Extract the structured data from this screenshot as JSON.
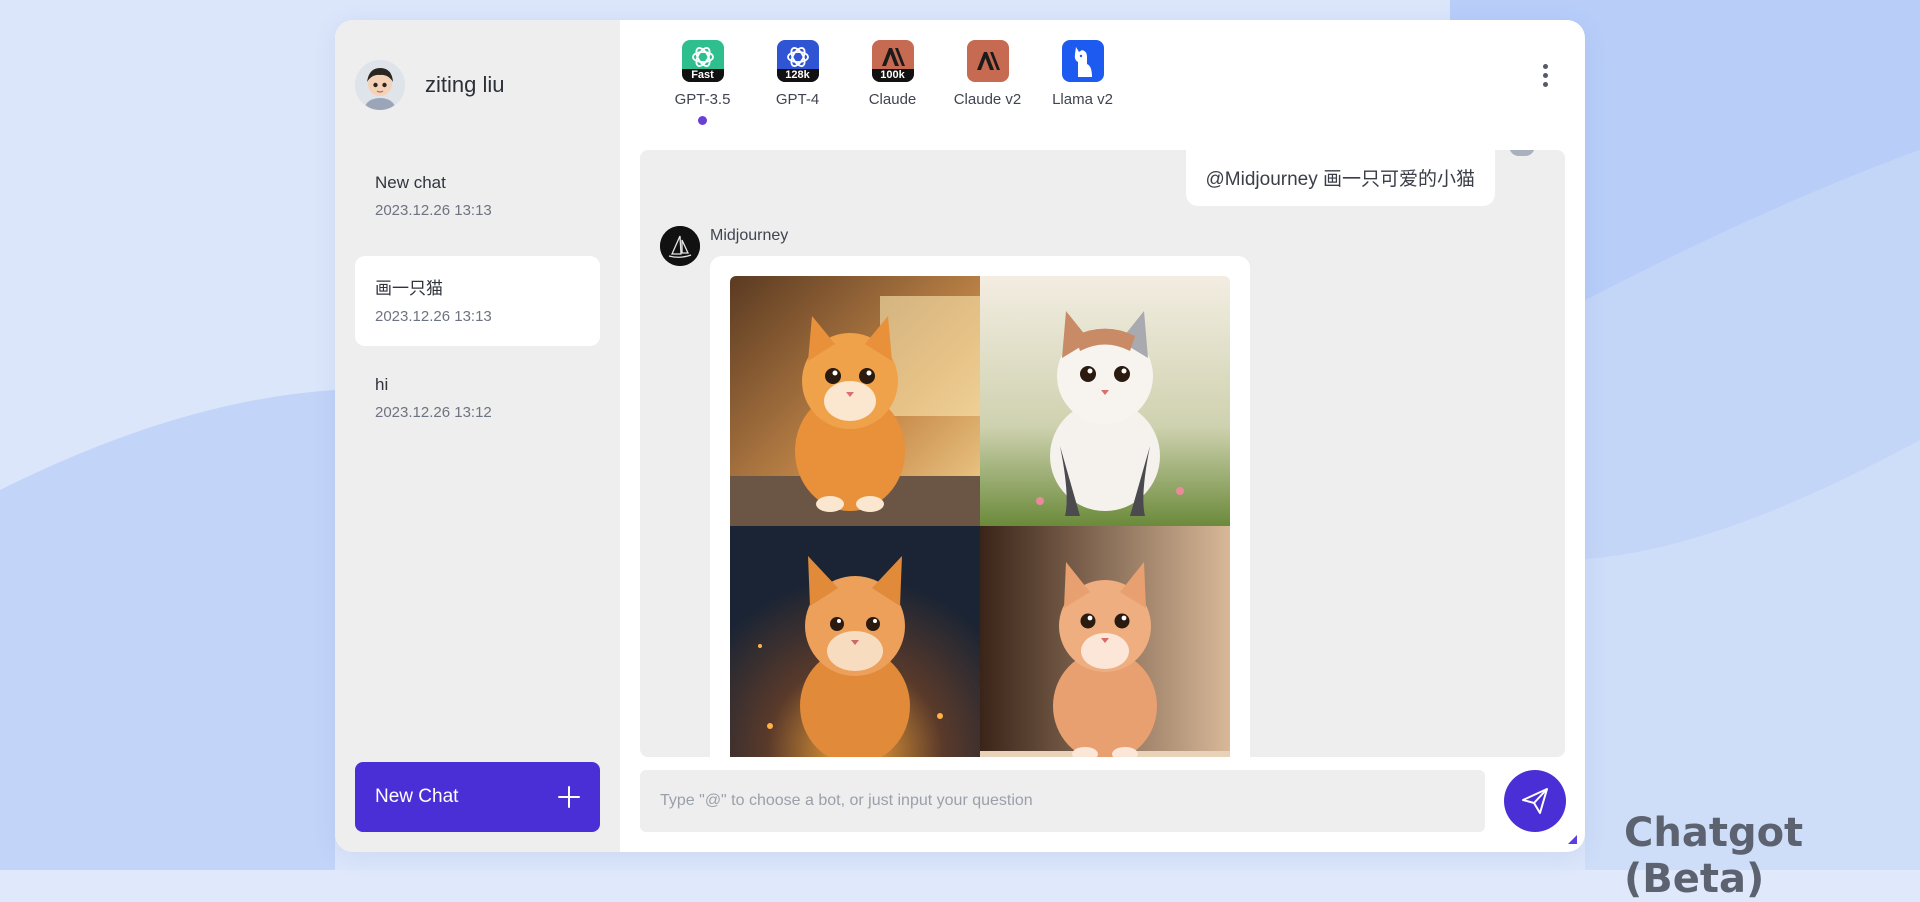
{
  "user": {
    "name": "ziting liu"
  },
  "chats": [
    {
      "title": "New chat",
      "time": "2023.12.26 13:13"
    },
    {
      "title": "画一只猫",
      "time": "2023.12.26 13:13"
    },
    {
      "title": "hi",
      "time": "2023.12.26 13:12"
    }
  ],
  "new_chat_label": "New Chat",
  "bots": [
    {
      "label": "GPT-3.5",
      "badge": "Fast",
      "color": "#2fbf8f",
      "icon": "openai-icon"
    },
    {
      "label": "GPT-4",
      "badge": "128k",
      "color": "#2f55d4",
      "icon": "openai-icon"
    },
    {
      "label": "Claude",
      "badge": "100k",
      "color": "#c76a52",
      "icon": "anthropic-icon"
    },
    {
      "label": "Claude v2",
      "badge": "",
      "color": "#c76a52",
      "icon": "anthropic-icon"
    },
    {
      "label": "Llama v2",
      "badge": "",
      "color": "#1d5bf0",
      "icon": "llama-icon"
    }
  ],
  "messages": {
    "user_text": "@Midjourney  画一只可爱的小猫",
    "bot_name": "Midjourney"
  },
  "input": {
    "placeholder": "Type \"@\" to choose a bot, or just input your question",
    "value": ""
  },
  "brand": "Chatgot (Beta)",
  "colors": {
    "accent": "#4a2fd6",
    "sidebar": "#eeeeee",
    "active_dot": "#6a3fd8"
  }
}
